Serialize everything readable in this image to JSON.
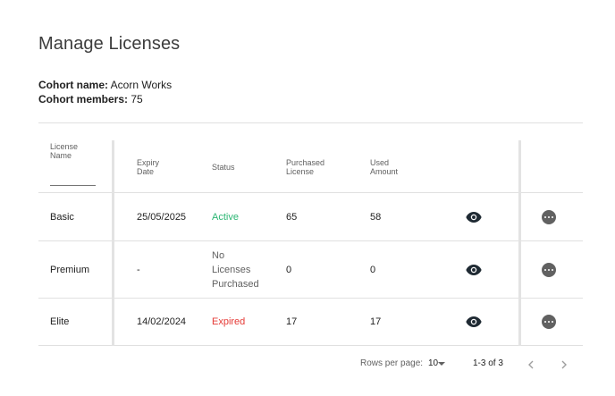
{
  "page": {
    "title": "Manage Licenses"
  },
  "cohort": {
    "name_label": "Cohort name:",
    "name_value": "Acorn Works",
    "members_label": "Cohort members:",
    "members_value": "75"
  },
  "table": {
    "columns": {
      "license_name": [
        "License",
        "Name"
      ],
      "expiry_date": [
        "Expiry",
        "Date"
      ],
      "status": [
        "Status"
      ],
      "purchased": [
        "Purchased",
        "License"
      ],
      "used": [
        "Used",
        "Amount"
      ]
    },
    "rows": [
      {
        "name": "Basic",
        "expiry": "25/05/2025",
        "status": "Active",
        "purchased": "65",
        "used": "58"
      },
      {
        "name": "Premium",
        "expiry": "-",
        "status_lines": [
          "No",
          "Licenses",
          "Purchased"
        ],
        "purchased": "0",
        "used": "0"
      },
      {
        "name": "Elite",
        "expiry": "14/02/2024",
        "status": "Expired",
        "purchased": "17",
        "used": "17"
      }
    ],
    "row_icons": {
      "view": "eye-icon",
      "actions": "more-horizontal-icon"
    }
  },
  "pagination": {
    "rows_per_page_label": "Rows per page:",
    "rows_per_page_value": "10",
    "range_label": "1-3 of 3",
    "prev_icon": "chevron-left-icon",
    "next_icon": "chevron-right-icon"
  },
  "colors": {
    "active": "#2bb673",
    "expired": "#e53935",
    "icon": "#1f2a33",
    "more": "#616161"
  }
}
